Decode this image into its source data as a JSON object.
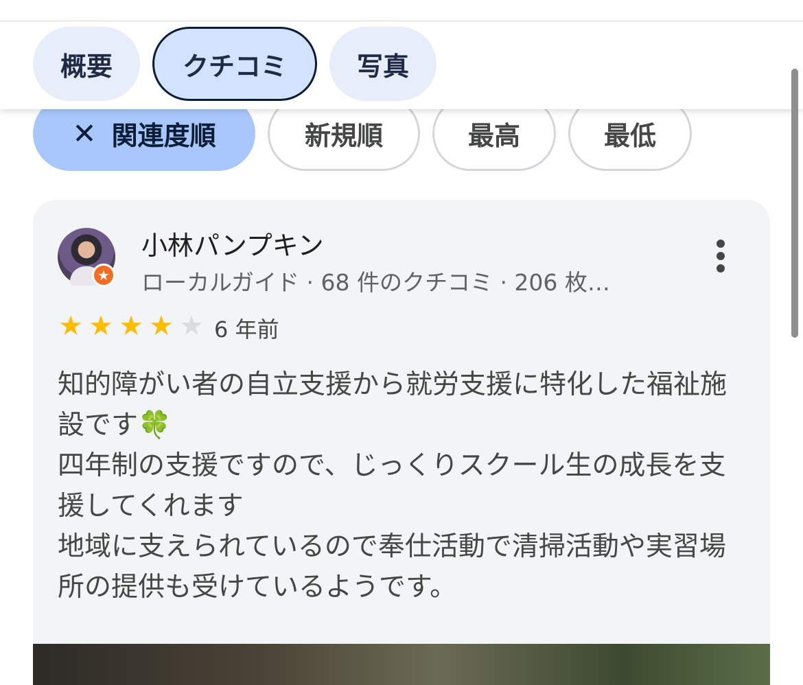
{
  "tabs": [
    {
      "label": "概要",
      "active": false
    },
    {
      "label": "クチコミ",
      "active": true
    },
    {
      "label": "写真",
      "active": false
    }
  ],
  "sort_chips": {
    "relevance": {
      "label": "関連度順",
      "selected": true,
      "icon": "close-icon"
    },
    "newest": {
      "label": "新規順"
    },
    "highest": {
      "label": "最高"
    },
    "lowest": {
      "label": "最低"
    }
  },
  "review": {
    "author": "小林パンプキン",
    "meta": "ローカルガイド · 68 件のクチコミ · 206 枚…",
    "rating": 4,
    "rating_max": 5,
    "date": "6 年前",
    "lines": [
      "知的障がい者の自立支援から就労支援に特化した福祉施設です",
      "四年制の支援ですので、じっくりスクール生の成長を支援してくれます",
      "地域に支えられているので奉仕活動で清掃活動や実習場所の提供も受けているようです。"
    ],
    "emoji": "🍀"
  },
  "colors": {
    "accent_chip": "#a8c7fa",
    "active_tab": "#d3e3fd",
    "star": "#fbbc04",
    "guide_badge": "#f26d21"
  }
}
